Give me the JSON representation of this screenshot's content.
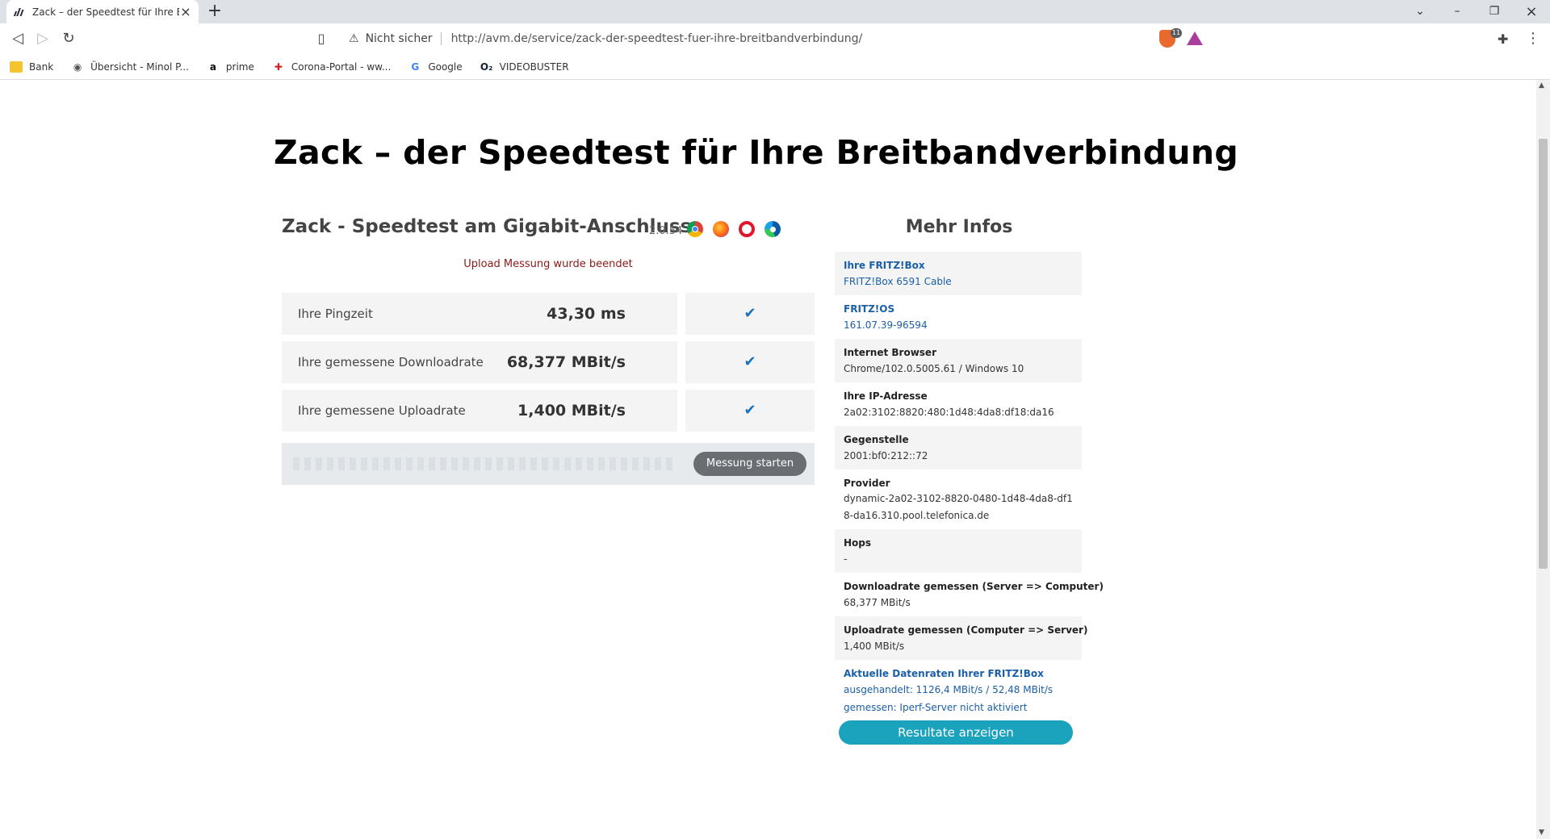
{
  "browser": {
    "tab_title": "Zack – der Speedtest für Ihre Breitbandverbindung",
    "address": {
      "security_label": "Nicht sicher",
      "url": "http://avm.de/service/zack-der-speedtest-fuer-ihre-breitbandverbindung/"
    },
    "brave_badge": "11",
    "bookmarks": [
      {
        "label": "Bank",
        "icon": "folder-icon"
      },
      {
        "label": "Übersicht - Minol P...",
        "icon": "globe-icon"
      },
      {
        "label": "prime",
        "icon": "amazon-icon"
      },
      {
        "label": "Corona-Portal - ww...",
        "icon": "shield-icon"
      },
      {
        "label": "Google",
        "icon": "google-icon"
      },
      {
        "label": "VIDEOBUSTER",
        "icon": "o2-icon"
      }
    ]
  },
  "page": {
    "title": "Zack – der Speedtest für Ihre Breitbandverbindung",
    "speedtest": {
      "heading": "Zack - Speedtest am Gigabit-Anschluss",
      "version": "2.0.54",
      "status": "Upload Messung wurde beendet",
      "results": [
        {
          "label": "Ihre Pingzeit",
          "value": "43,30 ms"
        },
        {
          "label": "Ihre gemessene Downloadrate",
          "value": "68,377 MBit/s"
        },
        {
          "label": "Ihre gemessene Uploadrate",
          "value": "1,400 MBit/s"
        }
      ],
      "start_button": "Messung starten"
    },
    "info": {
      "heading": "Mehr Infos",
      "items": [
        {
          "label": "Ihre FRITZ!Box",
          "value": "FRITZ!Box 6591 Cable"
        },
        {
          "label": "FRITZ!OS",
          "value": "161.07.39-96594"
        },
        {
          "label": "Internet Browser",
          "value": "Chrome/102.0.5005.61 / Windows 10"
        },
        {
          "label": "Ihre IP-Adresse",
          "value": "2a02:3102:8820:480:1d48:4da8:df18:da16"
        },
        {
          "label": "Gegenstelle",
          "value": "2001:bf0:212::72"
        },
        {
          "label": "Provider",
          "value": "dynamic-2a02-3102-8820-0480-1d48-4da8-df18-da16.310.pool.telefonica.de"
        },
        {
          "label": "Hops",
          "value": "-"
        },
        {
          "label": "Downloadrate gemessen (Server => Computer)",
          "value": "68,377 MBit/s"
        },
        {
          "label": "Uploadrate gemessen (Computer => Server)",
          "value": "1,400 MBit/s"
        },
        {
          "label": "Aktuelle Datenraten Ihrer FRITZ!Box",
          "value": "ausgehandelt: 1126,4 MBit/s / 52,48 MBit/s",
          "value2": "gemessen: Iperf-Server nicht aktiviert"
        }
      ],
      "result_button": "Resultate anzeigen"
    }
  }
}
